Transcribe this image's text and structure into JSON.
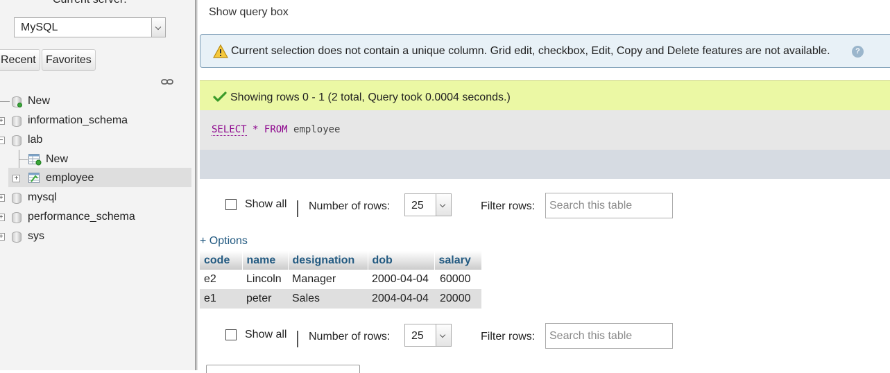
{
  "sidebar": {
    "server_label": "Current server:",
    "server_select": "MySQL",
    "recent_label": "Recent",
    "favorites_label": "Favorites",
    "tree": {
      "new_label": "New",
      "information_schema": "information_schema",
      "lab": "lab",
      "lab_new": "New",
      "employee": "employee",
      "mysql": "mysql",
      "performance_schema": "performance_schema",
      "sys": "sys"
    }
  },
  "main": {
    "show_query_box": "Show query box",
    "notice": "Current selection does not contain a unique column. Grid edit, checkbox, Edit, Copy and Delete features are not available.",
    "success": "Showing rows 0 - 1 (2 total, Query took 0.0004 seconds.)",
    "sql": {
      "select": "SELECT",
      "star": "*",
      "from": "FROM",
      "table": "employee"
    },
    "nav_top": {
      "show_all": "Show all",
      "rows_label": "Number of rows:",
      "rows_value": "25",
      "filter_label": "Filter rows:",
      "filter_placeholder": "Search this table"
    },
    "nav_bottom": {
      "show_all": "Show all",
      "rows_label": "Number of rows:",
      "rows_value": "25",
      "filter_label": "Filter rows:",
      "filter_placeholder": "Search this table"
    },
    "options_link": "+ Options",
    "table": {
      "columns": [
        "code",
        "name",
        "designation",
        "dob",
        "salary"
      ],
      "rows": [
        [
          "e2",
          "Lincoln",
          "Manager",
          "2000-04-04",
          "60000"
        ],
        [
          "e1",
          "peter",
          "Sales",
          "2004-04-04",
          "20000"
        ]
      ]
    }
  },
  "colors": {
    "sidebar_bg": "#f3f3f3",
    "notice_bg": "#e8f1f7",
    "success_bg": "#ebf8a4",
    "header_text": "#235a81",
    "sql_keyword": "#8b008b",
    "row_even_bg": "#dfdfdf"
  }
}
